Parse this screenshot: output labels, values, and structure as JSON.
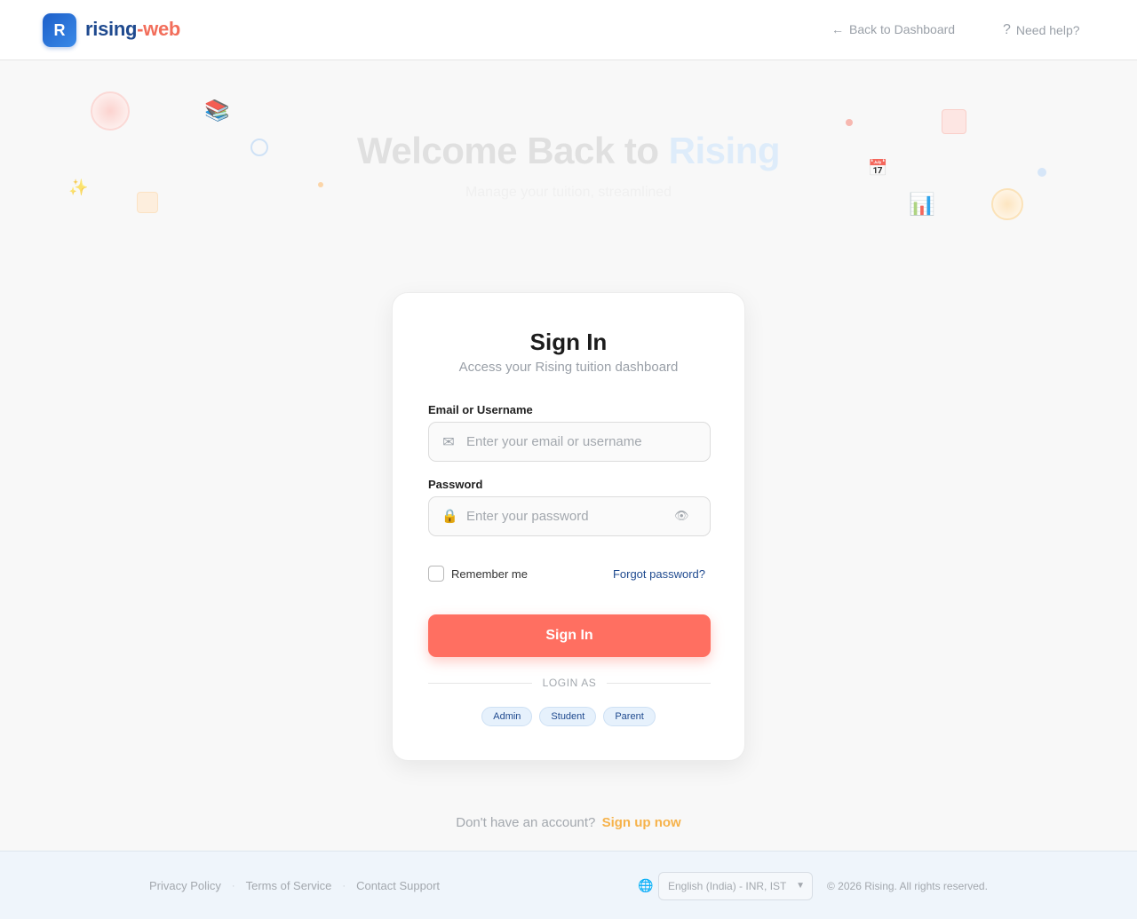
{
  "header": {
    "logo_letter": "R",
    "logo_name_a": "rising",
    "logo_name_b": "-web",
    "back_arrow": "←",
    "back_link": "Back to Dashboard",
    "help_symbol": "?",
    "help_link": "Need help?"
  },
  "hero": {
    "title_a": "Welcome Back to ",
    "title_b": "Rising",
    "subtitle": "Manage your tuition, streamlined"
  },
  "card": {
    "title": "Sign In",
    "subtitle": "Access your Rising tuition dashboard",
    "email_label": "Email or Username",
    "email_placeholder": "Enter your email or username",
    "password_label": "Password",
    "password_placeholder": "Enter your password",
    "remember_label": "Remember me",
    "forgot_link": "Forgot password?",
    "signin_button": "Sign In",
    "divider_text": "LOGIN AS",
    "roles": [
      "Admin",
      "Student",
      "Parent"
    ]
  },
  "signup": {
    "prompt": "Don't have an account?",
    "link": "Sign up now"
  },
  "footer": {
    "links": [
      "Privacy Policy",
      "Terms of Service",
      "Contact Support"
    ],
    "separator": "·",
    "language": "English (India) - INR, IST",
    "copyright": "© 2026 Rising. All rights reserved."
  },
  "icons": {
    "email": "mail-icon",
    "password": "lock-icon",
    "visibility": "eye-icon",
    "language": "globe-icon",
    "decor": [
      "books-icon",
      "sparkles-icon",
      "calendar-icon",
      "bar-chart-icon"
    ]
  },
  "colors": {
    "brand_primary": "#1f4a8f",
    "brand_accent": "#ff6f61",
    "signup_link": "#f6b24a",
    "role_chip_bg": "#e6f1fc"
  }
}
